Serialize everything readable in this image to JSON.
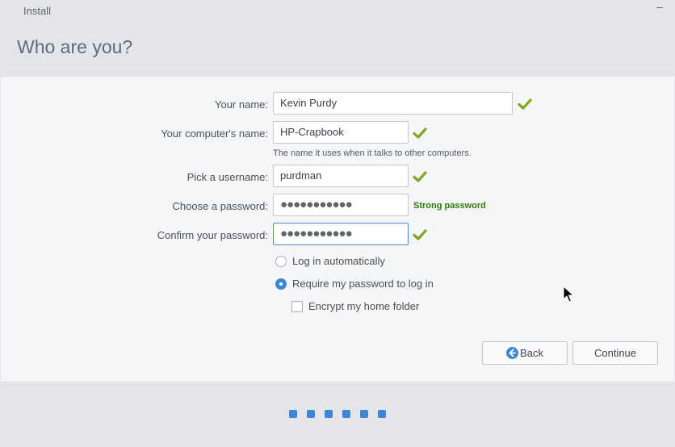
{
  "window": {
    "title": "Install",
    "minimize_glyph": "–"
  },
  "page": {
    "heading": "Who are you?"
  },
  "form": {
    "name": {
      "label": "Your name:",
      "value": "Kevin Purdy",
      "valid": true
    },
    "computer": {
      "label": "Your computer's name:",
      "value": "HP-Crapbook",
      "hint": "The name it uses when it talks to other computers.",
      "valid": true
    },
    "username": {
      "label": "Pick a username:",
      "value": "purdman",
      "valid": true
    },
    "password": {
      "label": "Choose a password:",
      "value": "●●●●●●●●●●●",
      "strength": "Strong password"
    },
    "confirm": {
      "label": "Confirm your password:",
      "value": "●●●●●●●●●●●",
      "valid": true
    },
    "login_options": [
      {
        "label": "Log in automatically",
        "selected": false
      },
      {
        "label": "Require my password to log in",
        "selected": true
      }
    ],
    "encrypt": {
      "label": "Encrypt my home folder",
      "checked": false
    }
  },
  "buttons": {
    "back": "Back",
    "continue": "Continue"
  },
  "progress": {
    "steps": 6
  },
  "colors": {
    "accent": "#3d86d6",
    "valid_check": "#7fa81f",
    "strength_text": "#2d7a0a",
    "background": "#e4e5e9",
    "panel": "#f5f6f7"
  },
  "icons": {
    "valid": "checkmark-icon",
    "back": "back-arrow-icon",
    "cursor": "mouse-pointer-icon"
  }
}
